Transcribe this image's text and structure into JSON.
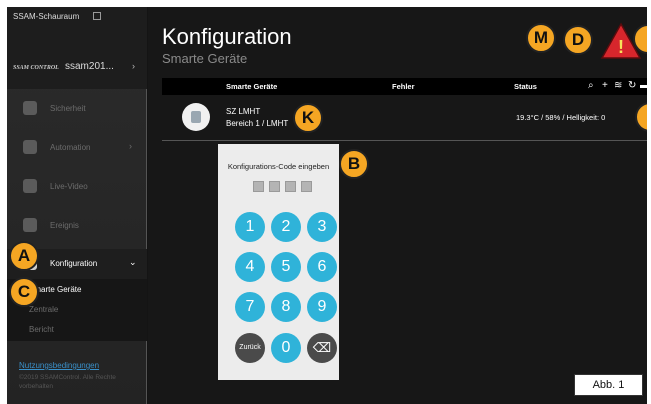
{
  "sidebar": {
    "title": "SSAM-Schauraum",
    "logo": "SSAM CONTROL",
    "device": "ssam201...",
    "items": [
      {
        "label": "Sicherheit",
        "arrow": ""
      },
      {
        "label": "Automation",
        "arrow": "›"
      },
      {
        "label": "Live-Video",
        "arrow": ""
      },
      {
        "label": "Ereignis",
        "arrow": ""
      },
      {
        "label": "Konfiguration",
        "arrow": "⌄"
      }
    ],
    "subitems": [
      "Smarte Geräte",
      "Zentrale",
      "Bericht"
    ],
    "footer_link": "Nutzungsbedingungen",
    "footer_copy": "©2019 SSAMControl. Alle Rechte vorbehalten"
  },
  "main": {
    "title": "Konfiguration",
    "subtitle": "Smarte Geräte",
    "columns": [
      "Smarte Geräte",
      "Fehler",
      "Status"
    ],
    "device": {
      "name": "SZ LMHT",
      "location": "Bereich 1 / LMHT",
      "status": "19.3°C / 58% / Helligkeit: 0"
    }
  },
  "keypad": {
    "title": "Konfigurations-Code eingeben",
    "keys": [
      "1",
      "2",
      "3",
      "4",
      "5",
      "6",
      "7",
      "8",
      "9",
      "Zurück",
      "0",
      "⌫"
    ]
  },
  "callouts": [
    "A",
    "B",
    "C",
    "D",
    "K",
    "M",
    "!"
  ],
  "figure_label": "Abb. 1",
  "icons": {
    "search": "search-icon",
    "add": "plus-icon",
    "wifi": "wifi-icon",
    "refresh": "refresh-icon",
    "delete": "trash-icon",
    "warning": "warning-icon"
  },
  "colors": {
    "accent": "#2fb3d9",
    "callout": "#f5a623",
    "warning": "#d7262c"
  }
}
